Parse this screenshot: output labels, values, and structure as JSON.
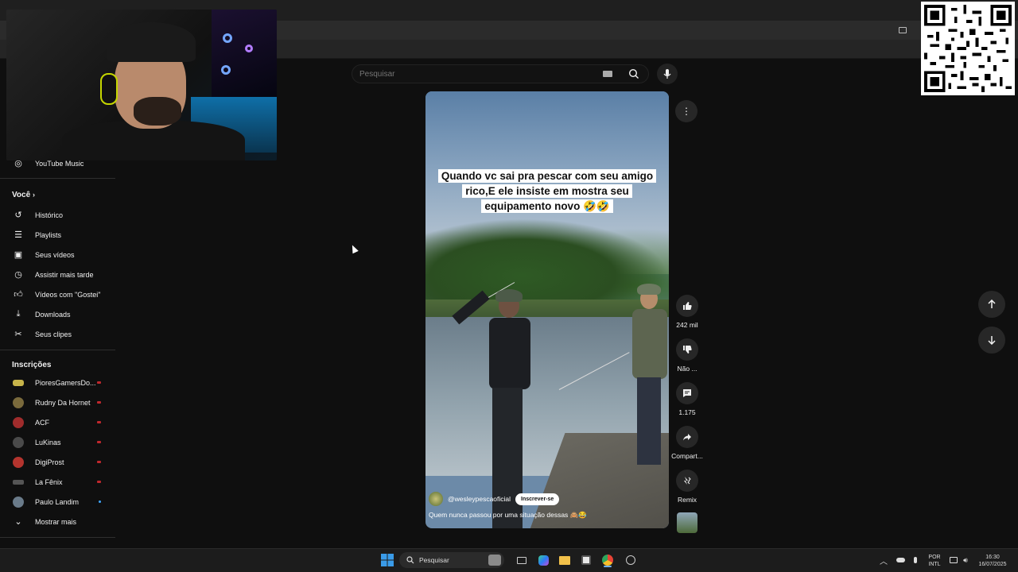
{
  "search": {
    "placeholder": "Pesquisar"
  },
  "sidebar": {
    "top_item": {
      "label": "YouTube Music",
      "icon": "youtube-music-icon"
    },
    "you_heading": "Você",
    "you_items": [
      {
        "label": "Histórico",
        "icon": "history-icon"
      },
      {
        "label": "Playlists",
        "icon": "playlists-icon"
      },
      {
        "label": "Seus vídeos",
        "icon": "your-videos-icon"
      },
      {
        "label": "Assistir mais tarde",
        "icon": "watch-later-icon"
      },
      {
        "label": "Vídeos com \"Gostei\"",
        "icon": "liked-icon"
      },
      {
        "label": "Downloads",
        "icon": "download-icon"
      },
      {
        "label": "Seus clipes",
        "icon": "clips-icon"
      }
    ],
    "subs_heading": "Inscrições",
    "subscriptions": [
      {
        "label": "PioresGamersDo..."
      },
      {
        "label": "Rudny Da Hornet"
      },
      {
        "label": "ACF"
      },
      {
        "label": "LuKinas"
      },
      {
        "label": "DigiProst"
      },
      {
        "label": "La Fênix"
      },
      {
        "label": "Paulo Landim"
      }
    ],
    "show_more": "Mostrar mais"
  },
  "video": {
    "caption": "Quando vc sai pra pescar com seu amigo rico,E ele insiste em mostra seu equipamento novo 🤣🤣",
    "channel": "@wesleypescaoficial",
    "subscribe_label": "Inscrever-se",
    "description": "Quem nunca passou por uma situação dessas 🙈😂"
  },
  "actions": {
    "likes": "242 mil",
    "dislike": "Não ...",
    "comments": "1.175",
    "share": "Compart...",
    "remix": "Remix"
  },
  "taskbar": {
    "search_placeholder": "Pesquisar",
    "lang_line1": "POR",
    "lang_line2": "INTL",
    "time": "16:30",
    "date": "16/07/2025"
  },
  "colors": {
    "background": "#0f0f0f",
    "subscription_dot": "#c0282d",
    "live_dot": "#3ea6ff"
  }
}
